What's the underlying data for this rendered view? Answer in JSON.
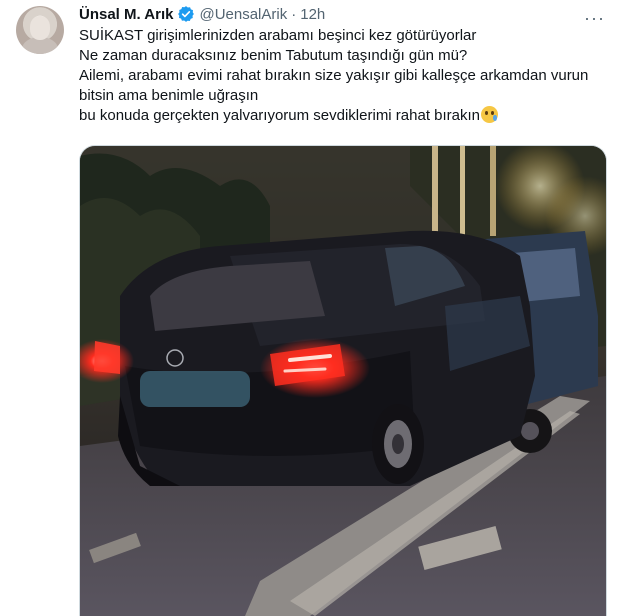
{
  "author": {
    "name": "Ünsal M. Arık",
    "handle": "@UensalArik",
    "separator": "·",
    "time": "12h",
    "verified": true
  },
  "tweet": {
    "lines": [
      "SUİKAST girişimlerinizden arabamı beşinci kez götürüyorlar",
      "Ne zaman duracaksınız benim Tabutum taşındığı gün mü?",
      "Ailemi, arabamı evimi rahat bırakın size yakışır gibi kalleşçe arkamdan vurun bitsin ama benimle uğraşın",
      "bu konuda gerçekten yalvarıyorum sevdiklerimi rahat bırakın"
    ],
    "trailing_emoji": "crying-face"
  },
  "more_button": "···",
  "colors": {
    "text": "#0f1419",
    "secondary": "#536471",
    "verified": "#1d9bf0",
    "border": "#cfd9de"
  }
}
